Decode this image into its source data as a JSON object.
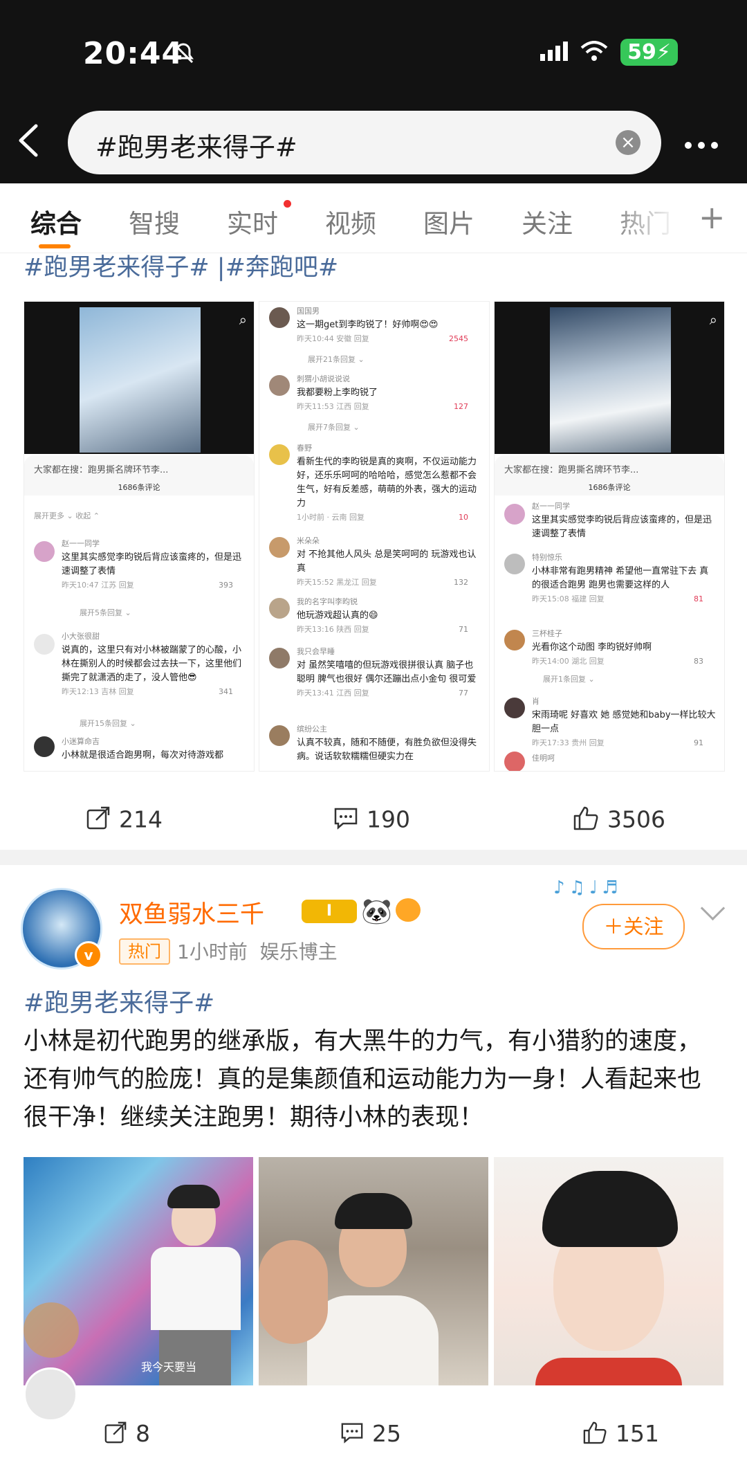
{
  "status_bar": {
    "time": "20:44",
    "battery": "59"
  },
  "search": {
    "query": "#跑男老来得子#"
  },
  "tabs": [
    {
      "label": "综合",
      "active": true
    },
    {
      "label": "智搜"
    },
    {
      "label": "实时",
      "dot": true
    },
    {
      "label": "视频"
    },
    {
      "label": "图片"
    },
    {
      "label": "关注"
    },
    {
      "label": "热门"
    }
  ],
  "post1": {
    "hashtags": "#跑男老来得子#  |#奔跑吧#",
    "stats": {
      "reposts": "214",
      "comments": "190",
      "likes": "3506"
    },
    "shot1": {
      "search_bar": "大家都在搜：跑男撕名牌环节李...",
      "count": "1686条评论",
      "expand": "展开更多 ⌄    收起 ⌃",
      "c1_name": "赵一一同学",
      "c1_text": "这里其实感觉李昀锐后背应该蛮疼的，但是迅速调整了表情",
      "c1_meta": "昨天10:47 江苏 回复",
      "c1_like": "393",
      "c1_more": "展开5条回复 ⌄",
      "c2_name": "小大张很甜",
      "c2_text": "说真的，这里只有对小林被踹蒙了的心酸，小林在撕别人的时候都会过去扶一下，这里他们撕完了就潇洒的走了，没人管他😎",
      "c2_meta": "昨天12:13 吉林 回复",
      "c2_like": "341",
      "c2_more": "展开15条回复 ⌄",
      "c3_name": "小迷算命吉",
      "c3_text": "小林就是很适合跑男啊，每次对待游戏都"
    },
    "shot2": {
      "c1_name": "国国男",
      "c1_text": "这一期get到李昀锐了！好帅啊😍😍",
      "c1_meta": "昨天10:44 安徽 回复",
      "c1_like": "2545",
      "c1_more": "展开21条回复 ⌄",
      "c2_name": "刺猬小胡说说说",
      "c2_text": "我都要粉上李昀锐了",
      "c2_meta": "昨天11:53 江西 回复",
      "c2_like": "127",
      "c2_more": "展开7条回复 ⌄",
      "c3_name": "春野",
      "c3_text": "看新生代的李昀锐是真的爽啊，不仅运动能力好，还乐乐呵呵的哈哈哈，感觉怎么惹都不会生气，好有反差感，萌萌的外表，强大的运动力",
      "c3_meta": "1小时前 · 云南 回复",
      "c3_like": "10",
      "c4_name": "米朵朵",
      "c4_text": "对 不抢其他人风头 总是笑呵呵的 玩游戏也认真",
      "c4_meta": "昨天15:52 黑龙江 回复",
      "c4_like": "132",
      "c5_name": "我的名字叫李昀锐",
      "c5_text": "他玩游戏超认真的😄",
      "c5_meta": "昨天13:16 陕西 回复",
      "c5_like": "71",
      "c6_name": "我只会早睡",
      "c6_text": "对 虽然笑嘻嘻的但玩游戏很拼很认真 脑子也聪明 脾气也很好 偶尔还蹦出点小金句 很可爱",
      "c6_meta": "昨天13:41 江西 回复",
      "c6_like": "77",
      "c7_name": "缤纷公主",
      "c7_text": "认真不较真，随和不随便，有胜负欲但没得失病。说话软软糯糯但硬实力在"
    },
    "shot3": {
      "search_bar": "大家都在搜：跑男撕名牌环节李...",
      "count": "1686条评论",
      "c1_name": "赵一一同学",
      "c1_text": "这里其实感觉李昀锐后背应该蛮疼的，但是迅速调整了表情",
      "c2_name": "特别惊乐",
      "c2_text": "小林非常有跑男精神 希望他一直常驻下去 真的很适合跑男 跑男也需要这样的人",
      "c2_meta": "昨天15:08 福建 回复",
      "c2_like": "81",
      "c3_name": "三杯桂子",
      "c3_text": "光看你这个动图 李昀锐好帅啊",
      "c3_meta": "昨天14:00 湖北 回复",
      "c3_like": "83",
      "c3_more": "展开1条回复 ⌄",
      "c4_name": "肖",
      "c4_text": "宋雨琦呢 好喜欢 她 感觉她和baby一样比较大胆一点",
      "c4_meta": "昨天17:33 贵州 回复",
      "c4_like": "91",
      "c5_name": "佳明呵"
    }
  },
  "post2": {
    "username": "双鱼弱水三千",
    "level_badge": "I",
    "hot_tag": "热门",
    "time": "1小时前",
    "category": "娱乐博主",
    "follow_label": "＋关注",
    "hashtag": "#跑男老来得子#",
    "body": "小林是初代跑男的继承版，有大黑牛的力气，有小猎豹的速度，还有帅气的脸庞！真的是集颜值和运动能力为一身！人看起来也很干净！继续关注跑男！期待小林的表现！",
    "photo1_caption": "我今天要当",
    "stats": {
      "reposts": "8",
      "comments": "25",
      "likes": "151"
    }
  }
}
